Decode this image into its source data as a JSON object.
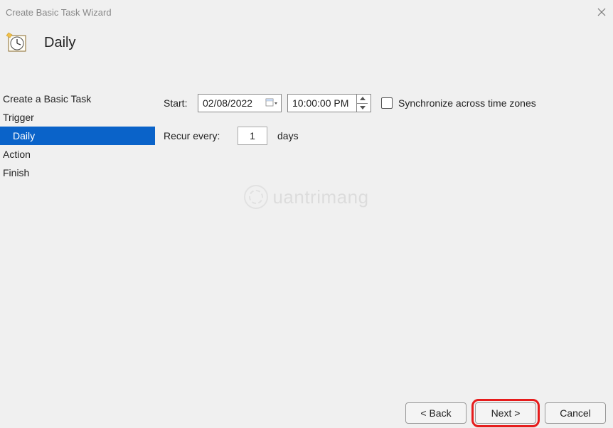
{
  "titlebar": {
    "title": "Create Basic Task Wizard"
  },
  "header": {
    "heading": "Daily"
  },
  "sidebar": {
    "steps": [
      {
        "label": "Create a Basic Task",
        "indent": false,
        "selected": false
      },
      {
        "label": "Trigger",
        "indent": false,
        "selected": false
      },
      {
        "label": "Daily",
        "indent": true,
        "selected": true
      },
      {
        "label": "Action",
        "indent": false,
        "selected": false
      },
      {
        "label": "Finish",
        "indent": false,
        "selected": false
      }
    ]
  },
  "form": {
    "start_label": "Start:",
    "date_value": "02/08/2022",
    "time_value": "10:00:00 PM",
    "sync_label": "Synchronize across time zones",
    "recur_label": "Recur every:",
    "recur_value": "1",
    "recur_suffix": "days"
  },
  "buttons": {
    "back": "< Back",
    "next": "Next >",
    "cancel": "Cancel"
  },
  "watermark": {
    "text": "uantrimang"
  }
}
